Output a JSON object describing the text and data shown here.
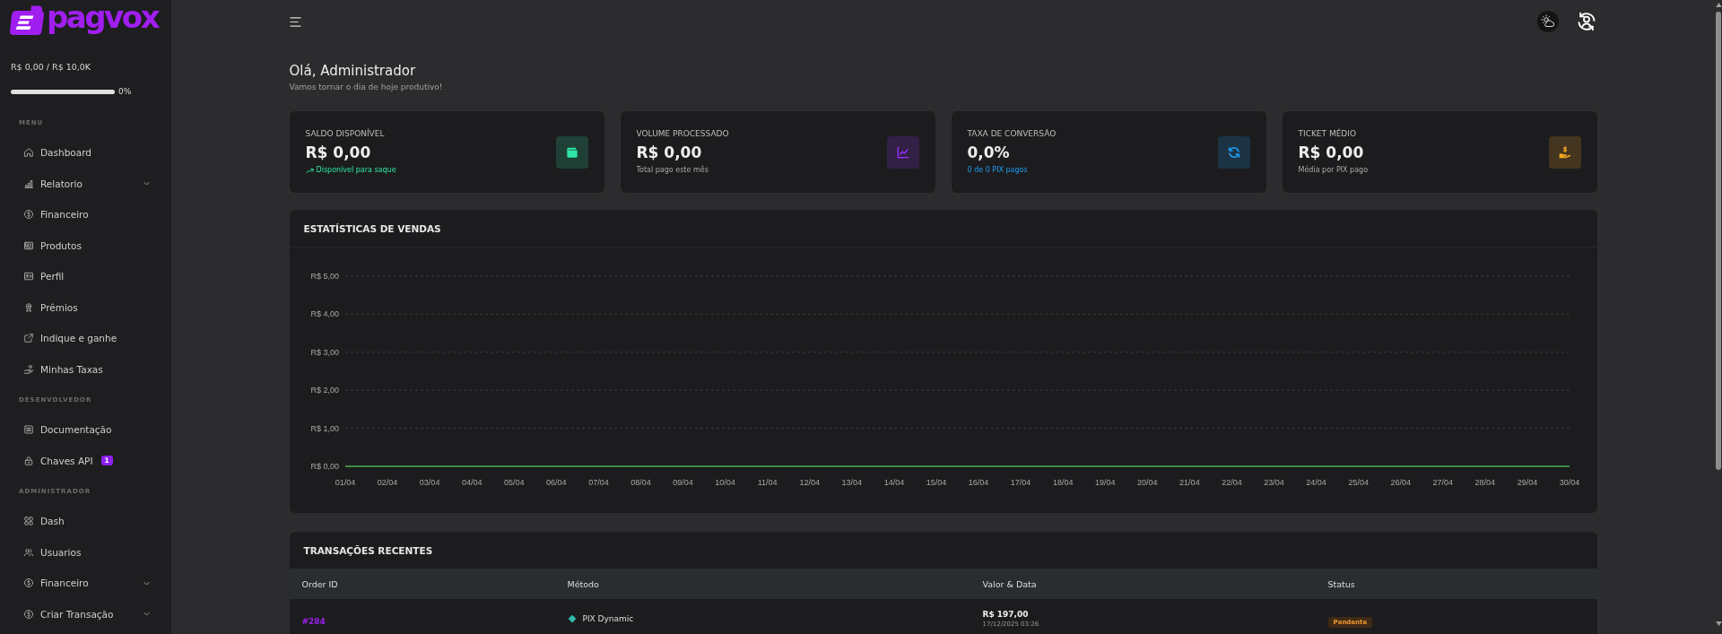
{
  "sidebar": {
    "brand": "pagvox",
    "budget": {
      "text": "R$ 0,00 / R$ 10,0K",
      "reading": "0%"
    },
    "sections": [
      {
        "title": "MENU",
        "items": [
          {
            "label": "Dashboard",
            "kind": "link",
            "selected": false
          },
          {
            "label": "Relatorio",
            "kind": "group",
            "expanded": false,
            "selected": false
          },
          {
            "label": "Financeiro",
            "kind": "link",
            "selected": false
          },
          {
            "label": "Produtos",
            "kind": "link",
            "selected": false
          },
          {
            "label": "Perfil",
            "kind": "link",
            "selected": false
          },
          {
            "label": "Prêmios",
            "kind": "link",
            "selected": false
          },
          {
            "label": "Indique e ganhe",
            "kind": "link",
            "selected": false
          },
          {
            "label": "Minhas Taxas",
            "kind": "link",
            "selected": false
          }
        ]
      },
      {
        "title": "DESENVOLVEDOR",
        "items": [
          {
            "label": "Documentação",
            "kind": "link",
            "selected": false
          },
          {
            "label": "Chaves API",
            "kind": "link",
            "selected": false,
            "badge": "1"
          }
        ]
      },
      {
        "title": "ADMINISTRADOR",
        "items": [
          {
            "label": "Dash",
            "kind": "link",
            "selected": false
          },
          {
            "label": "Usuarios",
            "kind": "link",
            "selected": false
          },
          {
            "label": "Financeiro",
            "kind": "group",
            "expanded": false,
            "selected": false
          },
          {
            "label": "Criar Transação",
            "kind": "group",
            "expanded": false,
            "selected": false
          }
        ]
      }
    ]
  },
  "greeting": {
    "title": "Olá, Administrador",
    "subtitle": "Vamos tornar o dia de hoje produtivo!"
  },
  "stats": [
    {
      "label": "SALDO DISPONÍVEL",
      "value": "R$ 0,00",
      "note": "Disponível para saque",
      "note_highlighted": true,
      "note_trend": true,
      "color": "#2ee6a6"
    },
    {
      "label": "VOLUME PROCESSADO",
      "value": "R$ 0,00",
      "note": "Total pago este mês",
      "note_highlighted": false,
      "note_trend": false,
      "color": "#9b30ff"
    },
    {
      "label": "TAXA DE CONVERSÃO",
      "value": "0,0%",
      "note": "0 de 0 PIX pagos",
      "note_highlighted": true,
      "note_trend": false,
      "color": "#1e9cf0"
    },
    {
      "label": "TICKET MÉDIO",
      "value": "R$ 0,00",
      "note": "Média por PIX pago",
      "note_highlighted": false,
      "note_trend": false,
      "color": "#f5a623"
    }
  ],
  "sales_chart": {
    "title": "ESTATÍSTICAS DE VENDAS",
    "y_axis_labels": [
      "R$ 5,00",
      "R$ 4,00",
      "R$ 3,00",
      "R$ 2,00",
      "R$ 1,00",
      "R$ 0,00"
    ],
    "x_axis_labels": [
      "01/04",
      "02/04",
      "03/04",
      "04/04",
      "05/04",
      "06/04",
      "07/04",
      "08/04",
      "09/04",
      "10/04",
      "11/04",
      "12/04",
      "13/04",
      "14/04",
      "15/04",
      "16/04",
      "17/04",
      "18/04",
      "19/04",
      "20/04",
      "21/04",
      "22/04",
      "23/04",
      "24/04",
      "25/04",
      "26/04",
      "27/04",
      "28/04",
      "29/04",
      "30/04"
    ]
  },
  "transactions": {
    "title": "TRANSAÇÕES RECENTES",
    "columns": [
      "Order ID",
      "Método",
      "Valor & Data",
      "Status"
    ],
    "rows": [
      {
        "order_id": "#284",
        "method": "PIX Dynamic",
        "amount": "R$ 197,00",
        "date": "17/12/2025 03:26",
        "status": "Pendente"
      }
    ]
  }
}
